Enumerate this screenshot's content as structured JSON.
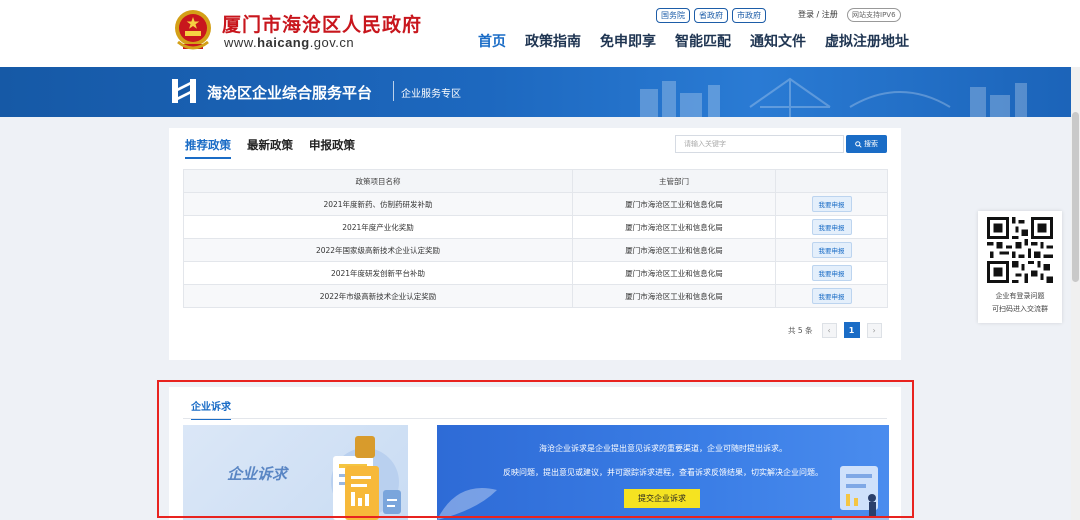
{
  "header": {
    "site_name": "厦门市海沧区人民政府",
    "site_url_prefix": "www.",
    "site_url_bold": "haicang",
    "site_url_suffix": ".gov.cn",
    "gov_links": [
      "国务院",
      "省政府",
      "市政府"
    ],
    "login": "登录 / 注册",
    "ipv6": "网站支持IPV6",
    "nav": [
      "首页",
      "政策指南",
      "免申即享",
      "智能匹配",
      "通知文件",
      "虚拟注册地址"
    ],
    "active_nav_index": 0
  },
  "banner": {
    "title": "海沧区企业综合服务平台",
    "subtitle": "企业服务专区"
  },
  "policy": {
    "tabs": [
      "推荐政策",
      "最新政策",
      "申报政策"
    ],
    "active_tab_index": 0,
    "search_placeholder": "请输入关键字",
    "search_button": "搜索",
    "columns": [
      "政策项目名称",
      "主管部门",
      ""
    ],
    "rows": [
      {
        "name": "2021年度新药、仿制药研发补助",
        "dept": "厦门市海沧区工业和信息化局",
        "action": "我要申报"
      },
      {
        "name": "2021年度产业化奖励",
        "dept": "厦门市海沧区工业和信息化局",
        "action": "我要申报"
      },
      {
        "name": "2022年国家级高新技术企业认定奖励",
        "dept": "厦门市海沧区工业和信息化局",
        "action": "我要申报"
      },
      {
        "name": "2021年度研发创新平台补助",
        "dept": "厦门市海沧区工业和信息化局",
        "action": "我要申报"
      },
      {
        "name": "2022年市级高新技术企业认定奖励",
        "dept": "厦门市海沧区工业和信息化局",
        "action": "我要申报"
      }
    ],
    "pager": {
      "total": "共 5 条",
      "current_page": "1",
      "prev": "‹",
      "next": "›"
    }
  },
  "qr": {
    "line1": "企业有登录问题",
    "line2": "可扫码进入交流群"
  },
  "appeal": {
    "tab": "企业诉求",
    "card_title": "企业诉求",
    "info_line1": "海沧企业诉求是企业提出意见诉求的重要渠道，企业可随时提出诉求。",
    "info_line2": "反映问题，提出意见或建议，并可跟踪诉求进程，查看诉求反馈结果，切实解决企业问题。",
    "submit_button": "提交企业诉求"
  },
  "colors": {
    "brand_blue": "#1a6cc6",
    "gov_red": "#c8161d",
    "highlight_red": "#e8231f",
    "submit_yellow": "#f5e321"
  }
}
